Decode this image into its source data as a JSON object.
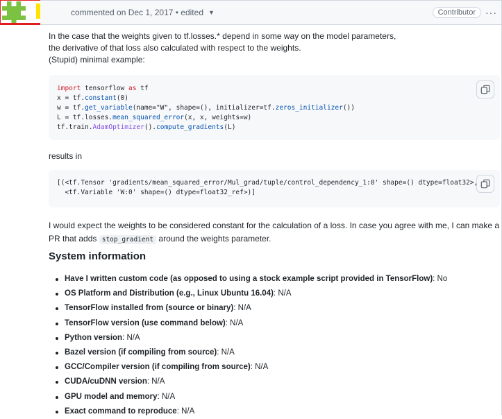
{
  "comment": {
    "meta_text": "commented on Dec 1, 2017 • edited",
    "badge": "Contributor",
    "menu_icon": "kebab-horizontal-icon"
  },
  "body": {
    "intro_line1": "In the case that the weights given to tf.losses.* depend in some way on the model parameters,",
    "intro_line2": "the derivative of that loss also calculated with respect to the weights.",
    "intro_line3": "(Stupid) minimal example:",
    "results_label": "results in",
    "expect_text_before": "I would expect the weights to be considered constant for the calculation of a loss. In case you agree with me, I can make a PR that adds ",
    "expect_inline_code": "stop_gradient",
    "expect_text_after": " around the weights parameter.",
    "system_heading": "System information"
  },
  "code_block_1": {
    "line1_kw": "import",
    "line1_rest": " tensorflow ",
    "line1_kw2": "as",
    "line1_end": " tf",
    "line2": "x = tf.",
    "line2_fn": "constant",
    "line2_end": "(0)",
    "line3": "w = tf.",
    "line3_fn": "get_variable",
    "line3_mid": "(name=\"W\", shape=(), initializer=tf.",
    "line3_fn2": "zeros_initializer",
    "line3_end": "())",
    "line4": "L = tf.losses.",
    "line4_fn": "mean_squared_error",
    "line4_end": "(x, x, weights=w)",
    "line5": "tf.train.",
    "line5_fn": "AdamOptimizer",
    "line5_mid": "().",
    "line5_fn2": "compute_gradients",
    "line5_end": "(L)"
  },
  "code_block_2": {
    "line1": "[(<tf.Tensor 'gradients/mean_squared_error/Mul_grad/tuple/control_dependency_1:0' shape=() dtype=float32>,",
    "line2": "  <tf.Variable 'W:0' shape=() dtype=float32_ref>)]"
  },
  "system_info": [
    {
      "label": "Have I written custom code (as opposed to using a stock example script provided in TensorFlow)",
      "value": ": No"
    },
    {
      "label": "OS Platform and Distribution (e.g., Linux Ubuntu 16.04)",
      "value": ": N/A"
    },
    {
      "label": "TensorFlow installed from (source or binary)",
      "value": ": N/A"
    },
    {
      "label": "TensorFlow version (use command below)",
      "value": ": N/A"
    },
    {
      "label": "Python version",
      "value": ": N/A"
    },
    {
      "label": "Bazel version (if compiling from source)",
      "value": ": N/A"
    },
    {
      "label": "GCC/Compiler version (if compiling from source)",
      "value": ": N/A"
    },
    {
      "label": "CUDA/cuDNN version",
      "value": ": N/A"
    },
    {
      "label": "GPU model and memory",
      "value": ": N/A"
    },
    {
      "label": "Exact command to reproduce",
      "value": ": N/A"
    }
  ],
  "colors": {
    "redaction": "#ffe400",
    "highlight_box": "#e11d1d",
    "avatar_green": "#7cc242"
  }
}
